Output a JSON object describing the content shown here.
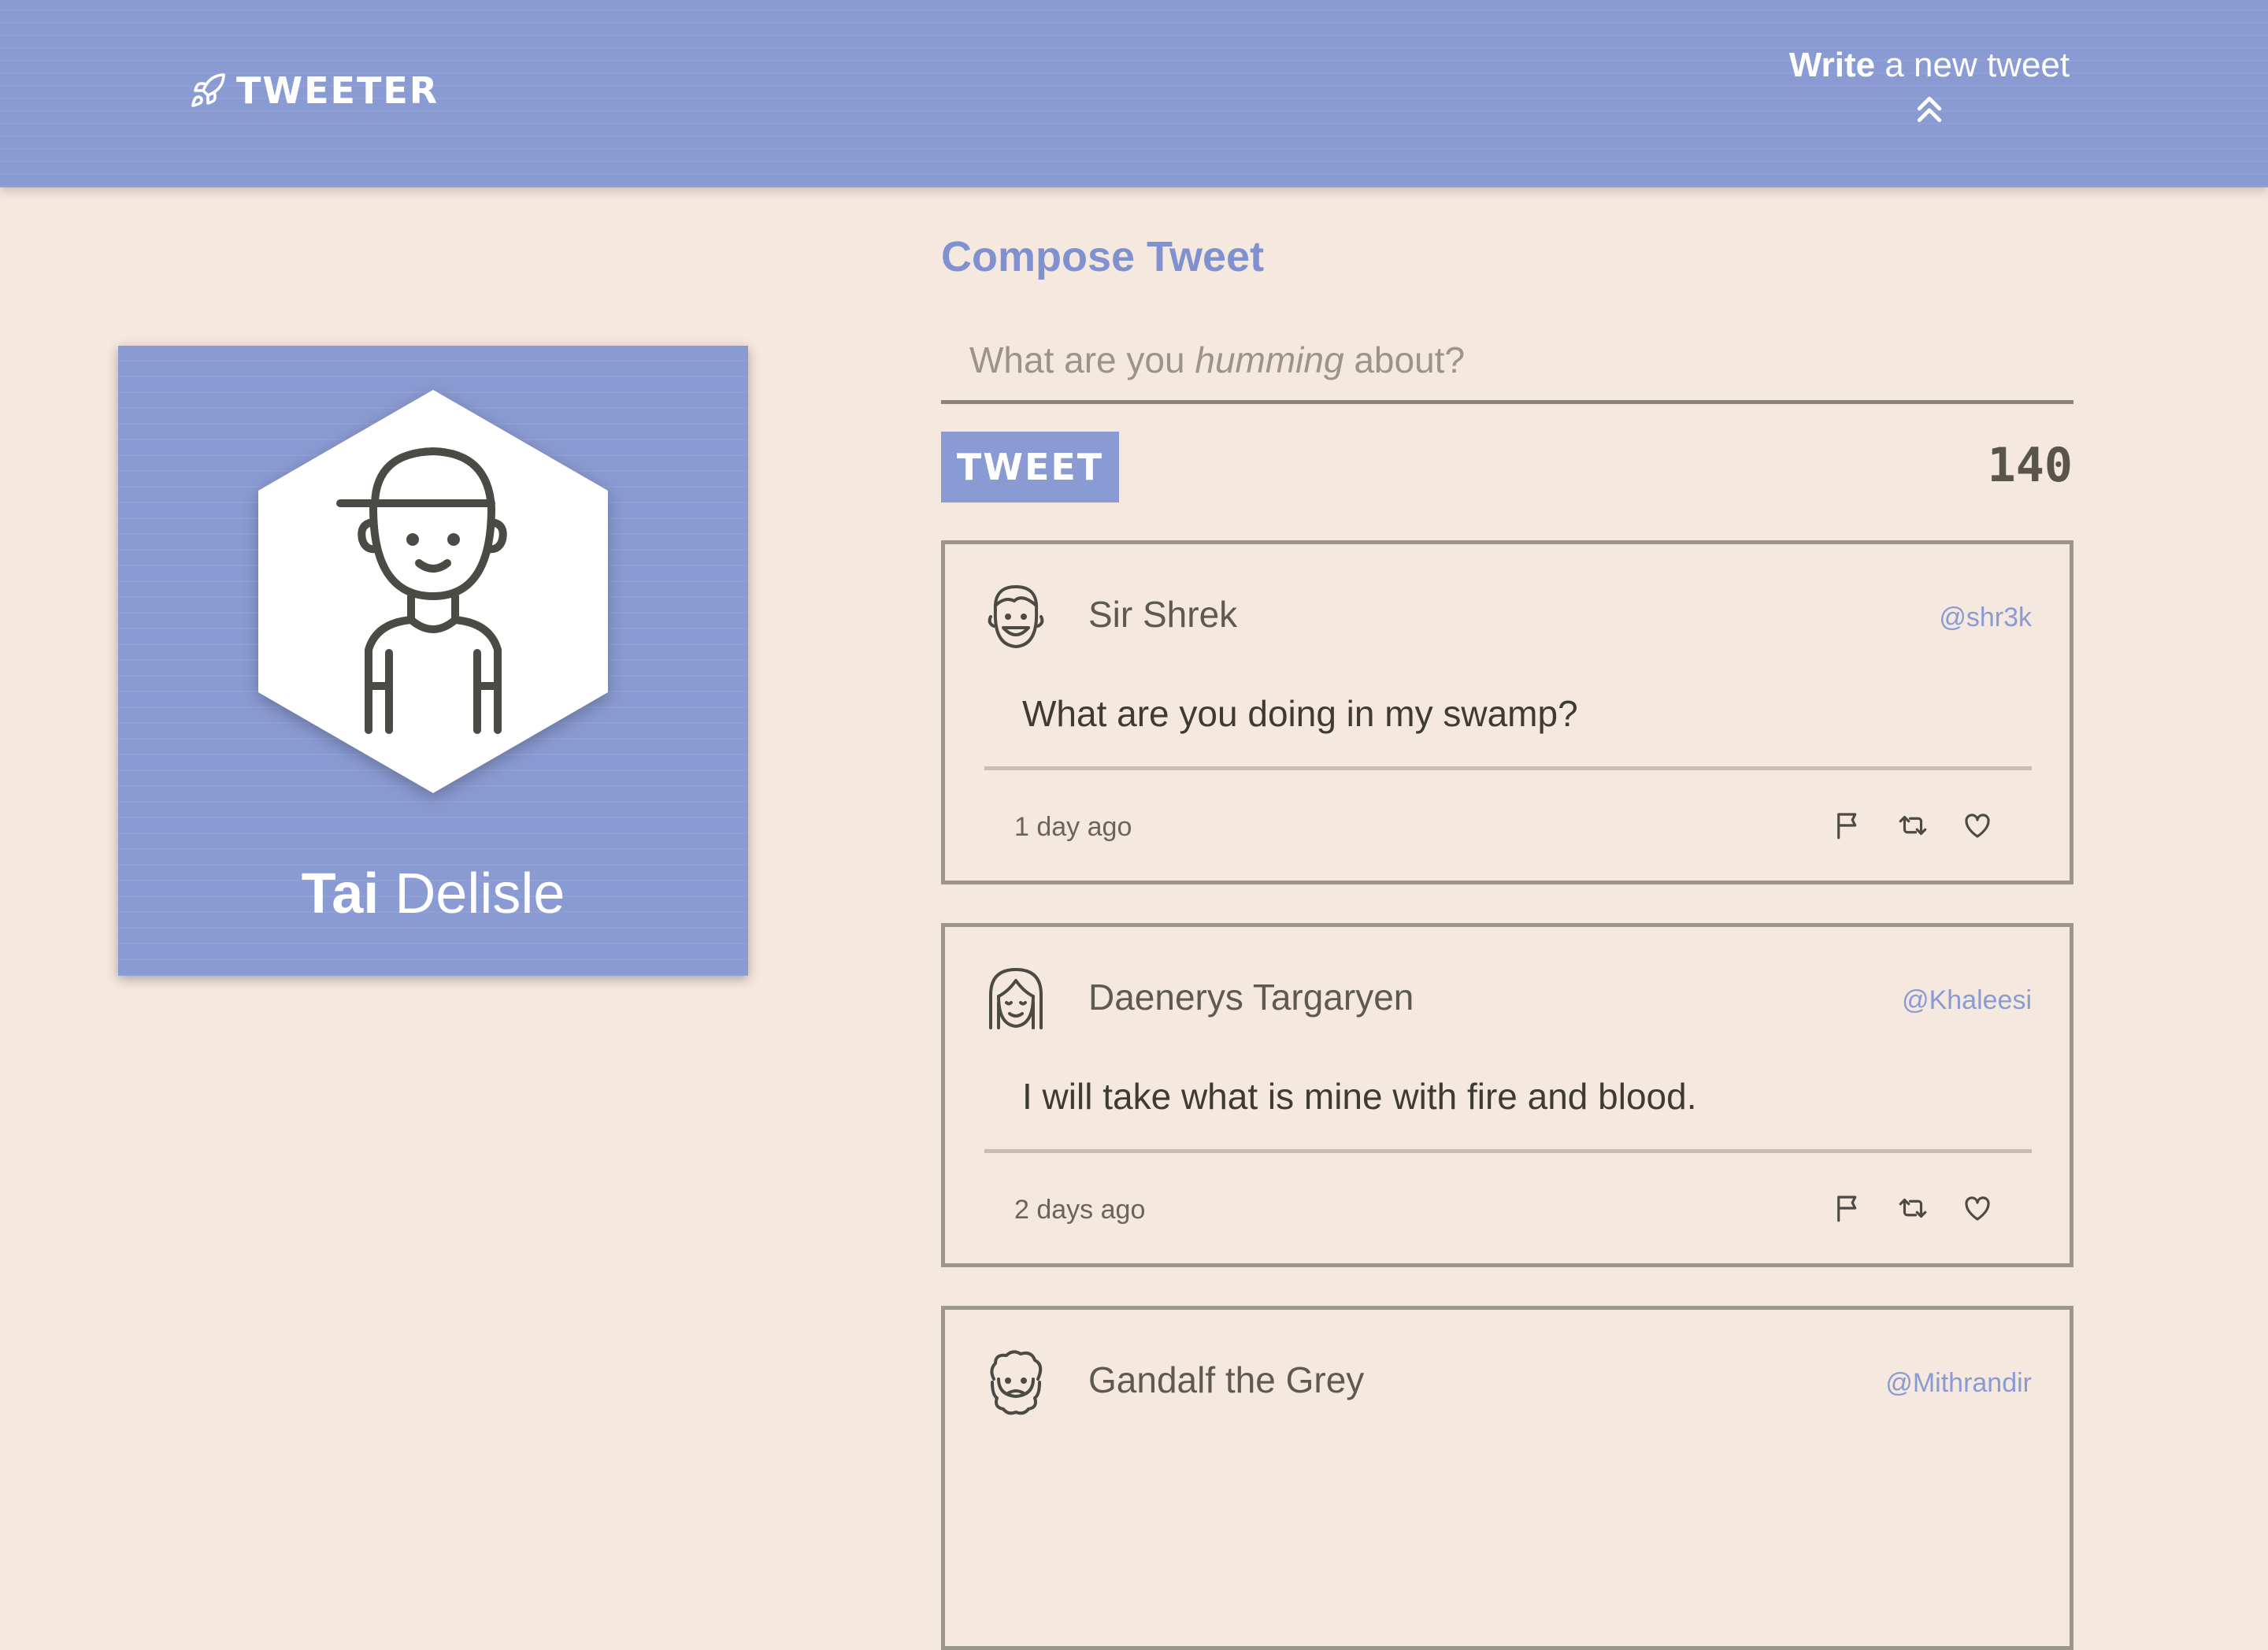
{
  "nav": {
    "brand": "TWEETER",
    "compose_strong": "Write",
    "compose_rest": "a new tweet"
  },
  "profile": {
    "first_name": "Tai",
    "last_name": "Delisle"
  },
  "compose": {
    "title": "Compose Tweet",
    "placeholder_pre": "What are you",
    "placeholder_em": "humming",
    "placeholder_post": "about?",
    "button_label": "TWEET",
    "counter": "140"
  },
  "tweets": [
    {
      "name": "Sir Shrek",
      "handle": "@shr3k",
      "text": "What are you doing in my swamp?",
      "time": "1 day ago"
    },
    {
      "name": "Daenerys Targaryen",
      "handle": "@Khaleesi",
      "text": "I will take what is mine with fire and blood.",
      "time": "2 days ago"
    },
    {
      "name": "Gandalf the Grey",
      "handle": "@Mithrandir"
    }
  ],
  "colors": {
    "accent": "#8a9bd3",
    "background": "#f5e8df",
    "border": "#9c968b"
  },
  "icons": [
    "rocket-icon",
    "double-chevron-up-icon",
    "flag-icon",
    "retweet-icon",
    "heart-icon"
  ]
}
